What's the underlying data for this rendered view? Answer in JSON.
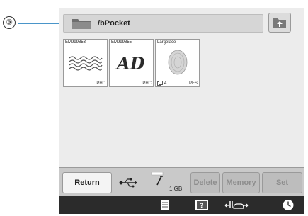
{
  "callout": {
    "number": "③"
  },
  "path_bar": {
    "path": "/bPocket",
    "icon": "folder-icon"
  },
  "up_button": {
    "icon": "folder-up-icon"
  },
  "files": [
    {
      "name": "EM999853",
      "format": "PHC",
      "preview": "wave-pattern"
    },
    {
      "name": "EM999855",
      "format": "PHC",
      "preview": "lettering-AD"
    },
    {
      "name": "Largelace",
      "format": "PES",
      "count": "4",
      "preview": "lace-oval"
    }
  ],
  "footer": {
    "return_label": "Return",
    "delete_label": "Delete",
    "memory_label": "Memory",
    "set_label": "Set",
    "memory_size": "1 GB",
    "usb_icon": "usb-icon",
    "memory_icon": "memory-icon"
  },
  "bottom_bar": {
    "icons": [
      "document-icon",
      "help-icon",
      "presser-foot-icon",
      "clock-icon"
    ]
  },
  "colors": {
    "screen_bg": "#ececec",
    "footer_bg": "#c9c9c9",
    "bottom_bar_bg": "#2b2b2b",
    "callout_line": "#4a95c9"
  }
}
